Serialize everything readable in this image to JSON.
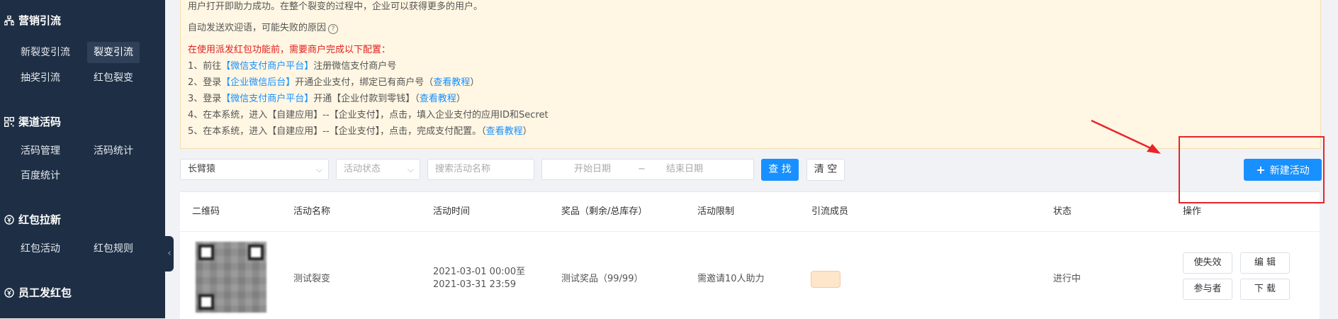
{
  "sidebar": {
    "sections": [
      {
        "title": "营销引流",
        "icon": "network-icon",
        "items": [
          {
            "label": "新裂变引流",
            "active": false
          },
          {
            "label": "裂变引流",
            "active": true
          },
          {
            "label": "抽奖引流",
            "active": false
          },
          {
            "label": "红包裂变",
            "active": false
          }
        ]
      },
      {
        "title": "渠道活码",
        "icon": "qrcode-icon",
        "items": [
          {
            "label": "活码管理"
          },
          {
            "label": "活码统计"
          },
          {
            "label": "百度统计"
          }
        ]
      },
      {
        "title": "红包拉新",
        "icon": "coin-icon",
        "items": [
          {
            "label": "红包活动"
          },
          {
            "label": "红包规则"
          }
        ]
      },
      {
        "title": "员工发红包",
        "icon": "coin-icon",
        "items": []
      }
    ]
  },
  "notice": {
    "line1": "用户打开即助力成功。在整个裂变的过程中，企业可以获得更多的用户。",
    "line2": "自动发送欢迎语，可能失败的原因",
    "warning": "在使用派发红包功能前，需要商户完成以下配置：",
    "steps": [
      {
        "pre": "1、前往",
        "link": "【微信支付商户平台】",
        "post": "注册微信支付商户号"
      },
      {
        "pre": "2、登录",
        "link": "【企业微信后台】",
        "post": "开通企业支付，绑定已有商户号（",
        "link2": "查看教程",
        "post2": "）"
      },
      {
        "pre": "3、登录",
        "link": "【微信支付商户平台】",
        "post": "开通【企业付款到零钱】（",
        "link2": "查看教程",
        "post2": "）"
      },
      {
        "pre": "4、在本系统，进入【自建应用】--【企业支付】，点击，填入企业支付的应用ID和Secret"
      },
      {
        "pre": "5、在本系统，进入【自建应用】--【企业支付】，点击，完成支付配置。（",
        "link2": "查看教程",
        "post2": "）"
      }
    ]
  },
  "filters": {
    "corp_select": "长臂猿",
    "status_placeholder": "活动状态",
    "search_placeholder": "搜索活动名称",
    "start_placeholder": "开始日期",
    "range_sep": "~",
    "end_placeholder": "结束日期",
    "search_btn": "查 找",
    "clear_btn": "清 空",
    "new_btn": "新建活动"
  },
  "table": {
    "headers": {
      "qrcode": "二维码",
      "name": "活动名称",
      "time": "活动时间",
      "prize": "奖品（剩余/总库存）",
      "limit": "活动限制",
      "members": "引流成员",
      "status": "状态",
      "ops": "操作"
    },
    "rows": [
      {
        "name": "测试裂变",
        "time_start": "2021-03-01 00:00至",
        "time_end": "2021-03-31 23:59",
        "prize": "测试奖品（99/99）",
        "limit": "需邀请10人助力",
        "status": "进行中",
        "ops": {
          "invalidate": "使失效",
          "edit": "编 辑",
          "participants": "参与者",
          "download": "下 载"
        }
      }
    ]
  },
  "colors": {
    "primary": "#1890ff",
    "sidebar": "#1e2f45",
    "warning": "#e02020",
    "notice_bg": "#fff6e3",
    "annotation": "#e8242a"
  }
}
